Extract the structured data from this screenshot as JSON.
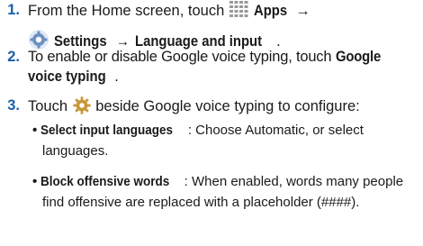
{
  "steps": [
    {
      "number": "1.",
      "line1_pre": "From the Home screen, touch",
      "line1_bold": "Apps",
      "arrow1": "→",
      "line2_bold": "Settings",
      "arrow2": "→",
      "line2_bold_end": "Language and input",
      "line2_end": ".",
      "icons": [
        "apps-grid-icon",
        "settings-gear-icon"
      ]
    },
    {
      "number": "2.",
      "line1_pre": "To enable or disable Google voice typing, touch",
      "line1_bold": "Google",
      "line2_bold": "voice typing",
      "line2_end": "."
    },
    {
      "number": "3.",
      "pre": "Touch",
      "post": "beside Google voice typing to configure:",
      "icons": [
        "settings-gear-icon"
      ]
    }
  ],
  "bullets": [
    {
      "title": "Select input languages",
      "text_line1": ": Choose Automatic, or select",
      "text_line2": "languages."
    },
    {
      "title": "Block offensive words",
      "text_line1": ": When enabled, words many people",
      "text_line2": "find offensive are replaced with a placeholder (####)."
    }
  ],
  "colors": {
    "step_number": "#1a5fa8",
    "text": "#1a1a1a"
  }
}
